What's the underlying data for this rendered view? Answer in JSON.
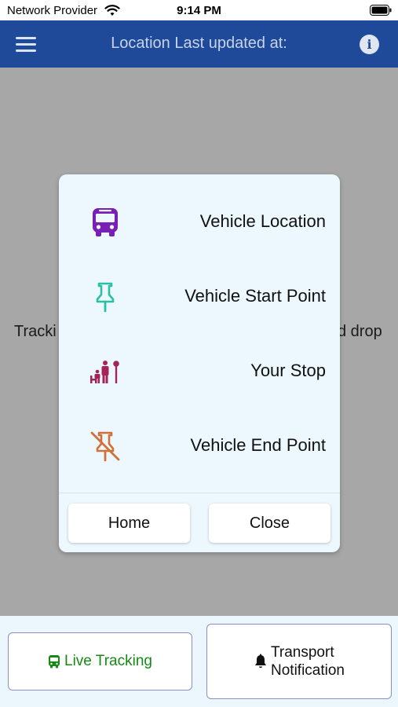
{
  "status_bar": {
    "carrier": "Network Provider",
    "time": "9:14 PM"
  },
  "header": {
    "title": "Location Last updated at:"
  },
  "background": {
    "text_left": "Tracki",
    "text_right": "d drop"
  },
  "legend_modal": {
    "items": [
      {
        "label": "Vehicle Location",
        "icon": "bus-icon",
        "color": "#7a1fb5"
      },
      {
        "label": "Vehicle Start Point",
        "icon": "pushpin-icon",
        "color": "#2bbfa3"
      },
      {
        "label": "Your Stop",
        "icon": "bus-stop-family-icon",
        "color": "#a3245a"
      },
      {
        "label": "Vehicle End Point",
        "icon": "pushpin-off-icon",
        "color": "#d1713a"
      }
    ],
    "home_label": "Home",
    "close_label": "Close"
  },
  "bottom_tabs": {
    "live_tracking_label": "Live Tracking",
    "live_tracking_color": "#148a14",
    "notification_line1": "Transport",
    "notification_line2": "Notification"
  },
  "colors": {
    "header_bg": "#1f4a99",
    "backdrop": "#a7a7a7",
    "modal_bg": "#ecf8fd"
  }
}
